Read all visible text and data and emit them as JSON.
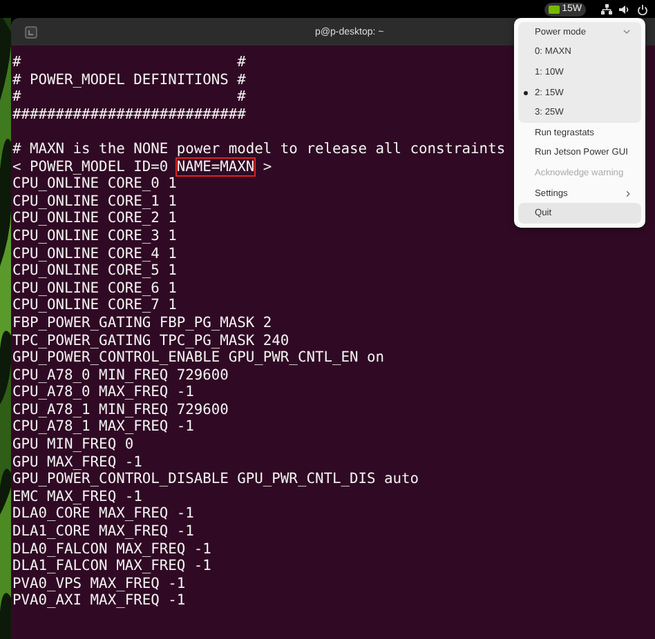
{
  "top_bar": {
    "power_badge": "15W"
  },
  "terminal": {
    "title": "p@p-desktop: ~",
    "lines": [
      {
        "kind": "text",
        "text": "#                         #"
      },
      {
        "kind": "text",
        "text": "# POWER_MODEL DEFINITIONS #"
      },
      {
        "kind": "text",
        "text": "#                         #"
      },
      {
        "kind": "text",
        "text": "###########################"
      },
      {
        "kind": "blank"
      },
      {
        "kind": "text",
        "text": "# MAXN is the NONE power model to release all constraints"
      },
      {
        "kind": "boxed",
        "before": "< POWER_MODEL ID=0 ",
        "boxed": "NAME=MAXN",
        "after": " >"
      },
      {
        "kind": "text",
        "text": "CPU_ONLINE CORE_0 1"
      },
      {
        "kind": "text",
        "text": "CPU_ONLINE CORE_1 1"
      },
      {
        "kind": "text",
        "text": "CPU_ONLINE CORE_2 1"
      },
      {
        "kind": "text",
        "text": "CPU_ONLINE CORE_3 1"
      },
      {
        "kind": "text",
        "text": "CPU_ONLINE CORE_4 1"
      },
      {
        "kind": "text",
        "text": "CPU_ONLINE CORE_5 1"
      },
      {
        "kind": "text",
        "text": "CPU_ONLINE CORE_6 1"
      },
      {
        "kind": "text",
        "text": "CPU_ONLINE CORE_7 1"
      },
      {
        "kind": "text",
        "text": "FBP_POWER_GATING FBP_PG_MASK 2"
      },
      {
        "kind": "text",
        "text": "TPC_POWER_GATING TPC_PG_MASK 240"
      },
      {
        "kind": "text",
        "text": "GPU_POWER_CONTROL_ENABLE GPU_PWR_CNTL_EN on"
      },
      {
        "kind": "text",
        "text": "CPU_A78_0 MIN_FREQ 729600"
      },
      {
        "kind": "text",
        "text": "CPU_A78_0 MAX_FREQ -1"
      },
      {
        "kind": "text",
        "text": "CPU_A78_1 MIN_FREQ 729600"
      },
      {
        "kind": "text",
        "text": "CPU_A78_1 MAX_FREQ -1"
      },
      {
        "kind": "text",
        "text": "GPU MIN_FREQ 0"
      },
      {
        "kind": "text",
        "text": "GPU MAX_FREQ -1"
      },
      {
        "kind": "text",
        "text": "GPU_POWER_CONTROL_DISABLE GPU_PWR_CNTL_DIS auto"
      },
      {
        "kind": "text",
        "text": "EMC MAX_FREQ -1"
      },
      {
        "kind": "text",
        "text": "DLA0_CORE MAX_FREQ -1"
      },
      {
        "kind": "text",
        "text": "DLA1_CORE MAX_FREQ -1"
      },
      {
        "kind": "text",
        "text": "DLA0_FALCON MAX_FREQ -1"
      },
      {
        "kind": "text",
        "text": "DLA1_FALCON MAX_FREQ -1"
      },
      {
        "kind": "text",
        "text": "PVA0_VPS MAX_FREQ -1"
      },
      {
        "kind": "text",
        "text": "PVA0_AXI MAX_FREQ -1"
      }
    ]
  },
  "menu": {
    "header": "Power mode",
    "expanded": true,
    "modes": [
      {
        "label": "0: MAXN",
        "selected": false
      },
      {
        "label": "1: 10W",
        "selected": false
      },
      {
        "label": "2: 15W",
        "selected": true
      },
      {
        "label": "3: 25W",
        "selected": false
      }
    ],
    "items": [
      {
        "label": "Run tegrastats",
        "kind": "action",
        "disabled": false,
        "highlighted": false
      },
      {
        "label": "Run Jetson Power GUI",
        "kind": "action",
        "disabled": false,
        "highlighted": false
      },
      {
        "label": "Acknowledge warning",
        "kind": "action",
        "disabled": true,
        "highlighted": false
      },
      {
        "label": "Settings",
        "kind": "submenu",
        "disabled": false,
        "highlighted": false
      },
      {
        "label": "Quit",
        "kind": "action",
        "disabled": false,
        "highlighted": true
      }
    ]
  }
}
